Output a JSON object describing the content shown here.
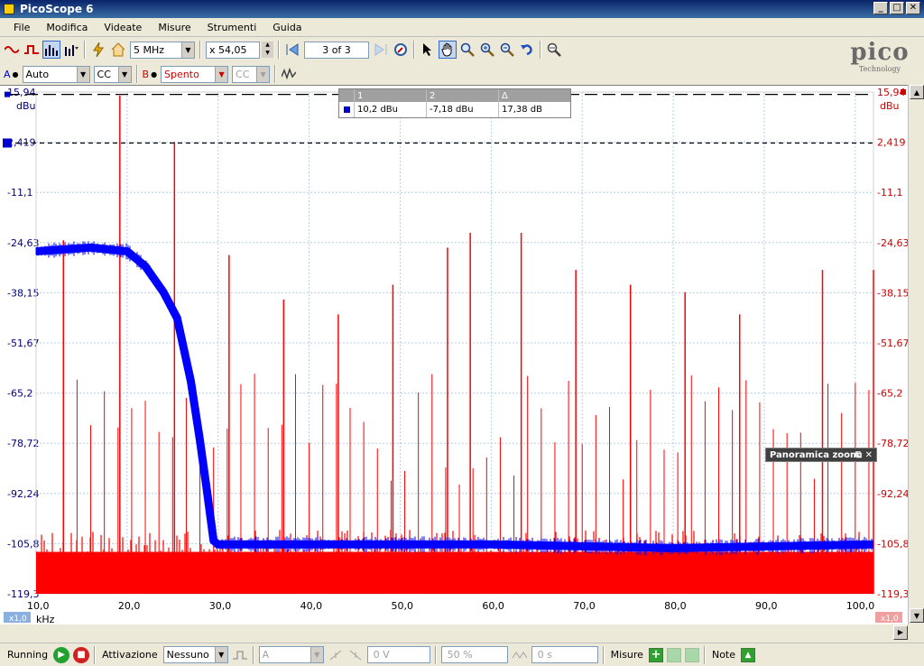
{
  "window": {
    "title": "PicoScope 6"
  },
  "menu": [
    "File",
    "Modifica",
    "Videate",
    "Misure",
    "Strumenti",
    "Guida"
  ],
  "toolbar": {
    "timebase": "5 MHz",
    "zoom": "x 54,05",
    "buffer": "3 of 3"
  },
  "channels": {
    "a": {
      "label": "A",
      "range": "Auto",
      "coupling": "CC",
      "color": "#0000cc"
    },
    "b": {
      "label": "B",
      "range": "Spento",
      "coupling": "CC",
      "color": "#cc0000"
    }
  },
  "logo": {
    "name": "pico",
    "sub": "Technology"
  },
  "axes": {
    "left_unit": "dBu",
    "right_unit": "dBu",
    "y_ticks": [
      "15,94",
      "2,419",
      "-11,1",
      "-24,63",
      "-38,15",
      "-51,67",
      "-65,2",
      "-78,72",
      "-92,24",
      "-105,8",
      "-119,3"
    ],
    "x_ticks": [
      "10,0",
      "20,0",
      "30,0",
      "40,0",
      "50,0",
      "60,0",
      "70,0",
      "80,0",
      "90,0",
      "100,0"
    ],
    "x_unit": "kHz",
    "x_scale": "x1,0",
    "right_scale": "x1,0"
  },
  "measurements": {
    "headers": [
      "1",
      "2",
      "Δ"
    ],
    "row": [
      "10,2 dBu",
      "-7,18 dBu",
      "17,38 dB"
    ]
  },
  "zoom_panel": {
    "title": "Panoramica zoom"
  },
  "status": {
    "run_state": "Running",
    "trigger_label": "Attivazione",
    "trigger_mode": "Nessuno",
    "trigger_source": "A",
    "threshold": "0 V",
    "pretrigger": "50 %",
    "delay": "0 s",
    "measures_label": "Misure",
    "notes_label": "Note"
  },
  "chart_data": {
    "type": "line",
    "xlabel": "kHz",
    "ylabel": "dBu",
    "xlim": [
      10.0,
      102.0
    ],
    "ylim": [
      -119.3,
      15.94
    ],
    "series": [
      {
        "name": "A",
        "color": "#0000ff",
        "x": [
          10,
          16,
          20,
          22,
          24,
          25.5,
          27,
          28,
          28.8,
          29.5,
          30,
          40,
          60,
          80,
          102
        ],
        "values": [
          -27,
          -26,
          -27,
          -31,
          -38,
          -45,
          -62,
          -78,
          -92,
          -105,
          -106,
          -106,
          -106,
          -107,
          -106
        ]
      },
      {
        "name": "B",
        "color": "#ff0000",
        "x": [
          13,
          19.2,
          25.2,
          31.2,
          37.2,
          43.2,
          49.2,
          55.2,
          57.7,
          63.3,
          69.3,
          75.3,
          81.3,
          87.3,
          96.4,
          102
        ],
        "values": [
          -24,
          15,
          2.5,
          -28,
          -40,
          -44,
          -36,
          -26,
          -22,
          -22,
          -32,
          -36,
          -38,
          -44,
          -32,
          -32
        ]
      }
    ],
    "cursors": [
      {
        "value": 15.3
      },
      {
        "value": 2.2
      }
    ]
  }
}
